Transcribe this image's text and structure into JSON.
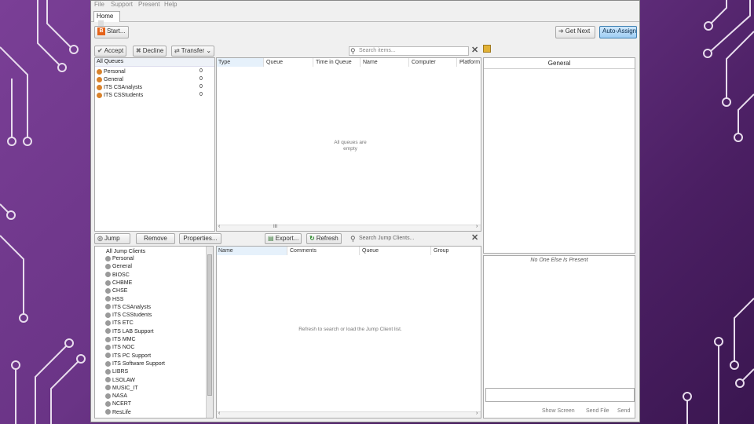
{
  "menu": [
    "File",
    "Support",
    "Present",
    "Help"
  ],
  "tab": {
    "label": "Home"
  },
  "toolbar": {
    "start": "Start...",
    "get_next": "Get Next",
    "auto_assign": "Auto-Assign"
  },
  "queue_actions": {
    "accept": "Accept",
    "decline": "Decline",
    "transfer": "Transfer"
  },
  "queues": {
    "header": "All Queues",
    "items": [
      {
        "name": "Personal",
        "count": "0",
        "color": "orange"
      },
      {
        "name": "General",
        "count": "0",
        "color": "orange"
      },
      {
        "name": "ITS CSAnalysts",
        "count": "0",
        "color": "orange"
      },
      {
        "name": "ITS CSStudents",
        "count": "0",
        "color": "orange"
      }
    ]
  },
  "session_search": {
    "placeholder": "Search items..."
  },
  "session_columns": [
    "Type",
    "Queue",
    "Time in Queue",
    "Name",
    "Computer",
    "Platform"
  ],
  "session_empty": "All queues are\nempty",
  "scroll_mid": "III",
  "general_panel": {
    "title": "General"
  },
  "jump_toolbar": {
    "jump": "Jump",
    "remove": "Remove",
    "properties": "Properties...",
    "export": "Export...",
    "refresh": "Refresh"
  },
  "jump_search": {
    "placeholder": "Search Jump Clients..."
  },
  "jump_groups": {
    "header": "All Jump Clients",
    "items": [
      "Personal",
      "General",
      "BIOSC",
      "CHBME",
      "CHSE",
      "HSS",
      "ITS CSAnalysts",
      "ITS CSStudents",
      "ITS ETC",
      "ITS LAB Support",
      "ITS MMC",
      "ITS NOC",
      "ITS PC Support",
      "ITS Software Support",
      "LIBRS",
      "LSOLAW",
      "MUSIC_IT",
      "NASA",
      "NCERT",
      "ResLife"
    ]
  },
  "jump_columns": [
    "Name",
    "Comments",
    "Queue",
    "Group"
  ],
  "jump_empty": "Refresh to search or load the Jump Client list.",
  "chat": {
    "no_one": "No One Else Is Present",
    "show_screen": "Show Screen",
    "send_file": "Send File",
    "send": "Send"
  },
  "colors": {
    "background": "#6a3486",
    "accent_button": "#9fcdf3",
    "start_icon": "#e5631a"
  }
}
